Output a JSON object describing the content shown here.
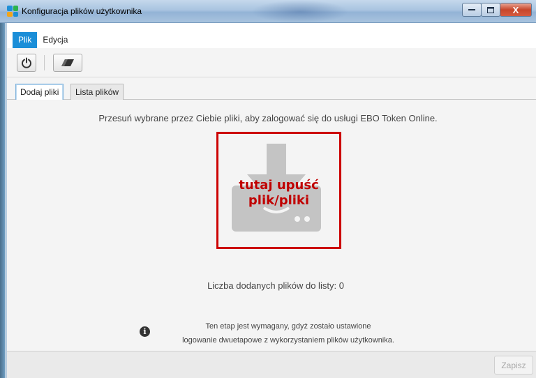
{
  "window": {
    "title": "Konfiguracja plików użytkownika",
    "controls": {
      "minimize": "—",
      "maximize": "□",
      "close": "X"
    }
  },
  "menu": {
    "items": [
      {
        "label": "Plik",
        "active": true
      },
      {
        "label": "Edycja",
        "active": false
      }
    ]
  },
  "toolbar": {
    "buttons": [
      {
        "icon": "power-icon"
      },
      {
        "icon": "eraser-icon"
      }
    ]
  },
  "tabs": [
    {
      "label": "Dodaj pliki",
      "active": true
    },
    {
      "label": "Lista plików",
      "active": false
    }
  ],
  "main": {
    "instruction": "Przesuń wybrane przez Ciebie pliki, aby zalogować się do usługi EBO Token Online.",
    "dropzone": {
      "line1": "tutaj upuść",
      "line2": "plik/pliki",
      "icon": "download-to-drive-icon",
      "border_color": "#cc0000"
    },
    "count_label": "Liczba dodanych plików do listy:",
    "count_value": "0",
    "info": {
      "icon": "info-icon",
      "line1": "Ten etap jest wymagany, gdyż zostało ustawione",
      "line2": "logowanie dwuetapowe z wykorzystaniem plików użytkownika."
    }
  },
  "footer": {
    "save_label": "Zapisz",
    "save_enabled": false
  },
  "colors": {
    "accent": "#1a8ed8",
    "drop_text": "#c00000"
  }
}
